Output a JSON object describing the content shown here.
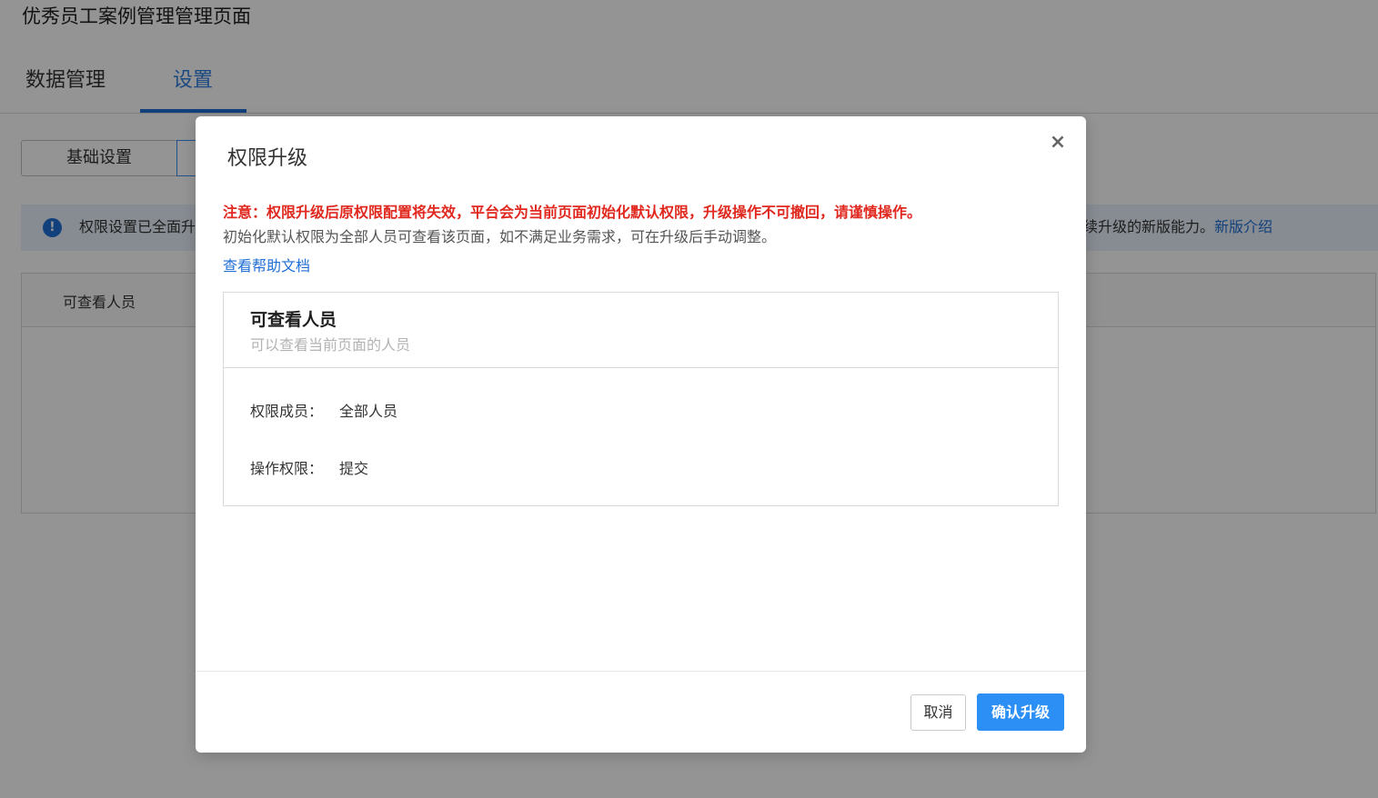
{
  "page": {
    "title": "优秀员工案例管理管理页面",
    "tabs": [
      {
        "label": "数据管理"
      },
      {
        "label": "设置"
      }
    ],
    "segments": [
      {
        "label": "基础设置"
      }
    ],
    "info_bar": {
      "left_text": "权限设置已全面升",
      "right_text": "续升级的新版能力。",
      "link_text": "新版介绍"
    },
    "table": {
      "column_header": "可查看人员"
    }
  },
  "modal": {
    "title": "权限升级",
    "warning": "注意：权限升级后原权限配置将失效，平台会为当前页面初始化默认权限，升级操作不可撤回，请谨慎操作。",
    "description": "初始化默认权限为全部人员可查看该页面，如不满足业务需求，可在升级后手动调整。",
    "help_link": "查看帮助文档",
    "card": {
      "title": "可查看人员",
      "subtitle": "可以查看当前页面的人员",
      "rows": [
        {
          "label": "权限成员：",
          "value": "全部人员"
        },
        {
          "label": "操作权限：",
          "value": "提交"
        }
      ]
    },
    "buttons": {
      "cancel": "取消",
      "confirm": "确认升级"
    },
    "close_icon": "×"
  },
  "colors": {
    "accent": "#1f6fd6",
    "primary_button": "#2b8ff5",
    "warning": "#e0281e"
  }
}
